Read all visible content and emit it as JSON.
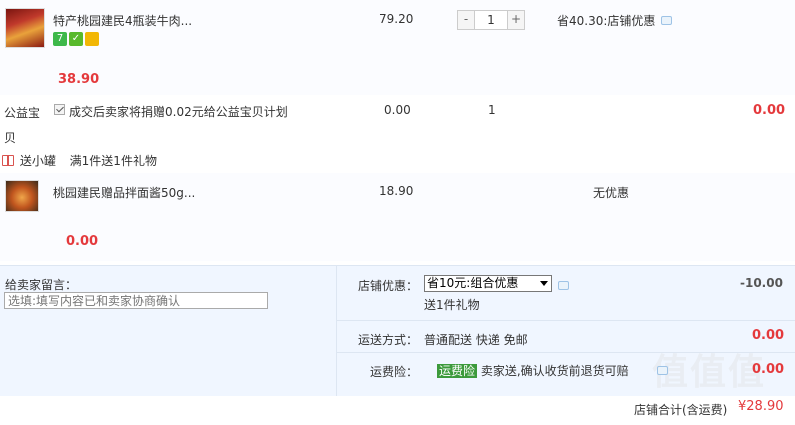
{
  "item1": {
    "name": "特产桃园建民4瓶装牛肉...",
    "price": "79.20",
    "quantity": "1",
    "minus_label": "-",
    "plus_label": "+",
    "discount": "省40.30:店铺优惠",
    "subtotal": "38.90",
    "badge_seven": "7"
  },
  "charity": {
    "label": "公益宝贝",
    "text": "成交后卖家将捐赠0.02元给公益宝贝计划",
    "price": "0.00",
    "quantity": "1",
    "subtotal": "0.00"
  },
  "gift": {
    "label": "送小罐",
    "rule": "满1件送1件礼物"
  },
  "item2": {
    "name": "桃园建民赠品拌面酱50g...",
    "price": "18.90",
    "discount": "无优惠",
    "subtotal": "0.00"
  },
  "message": {
    "label": "给卖家留言：",
    "placeholder": "选填:填写内容已和卖家协商确认"
  },
  "shop_discount": {
    "label": "店铺优惠：",
    "selected": "省10元:组合优惠",
    "note": "送1件礼物",
    "amount": "-10.00"
  },
  "shipping": {
    "label": "运送方式：",
    "value": "普通配送 快递 免邮",
    "amount": "0.00"
  },
  "insurance": {
    "label": "运费险：",
    "tag": "运费险",
    "text": "卖家送,确认收货前退货可赔",
    "amount": "0.00"
  },
  "total": {
    "label": "店铺合计(含运费)",
    "amount": "¥28.90"
  },
  "watermark": "值值值",
  "colors": {
    "accent_red": "#e4393c",
    "panel_bg": "#f0f6ff",
    "insurance_green": "#3c9a3c"
  }
}
